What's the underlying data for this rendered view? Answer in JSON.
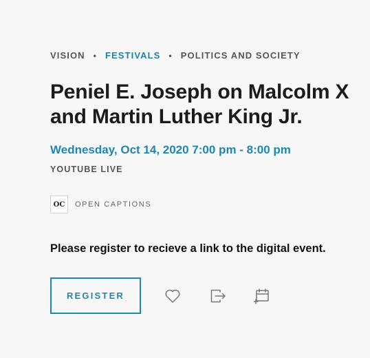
{
  "categories": [
    {
      "label": "VISION",
      "active": false
    },
    {
      "label": "FESTIVALS",
      "active": true
    },
    {
      "label": "POLITICS AND SOCIETY",
      "active": false
    }
  ],
  "separator": "•",
  "event": {
    "title": "Peniel E. Joseph on Malcolm X and Martin Luther King Jr.",
    "datetime": "Wednesday, Oct 14, 2020 7:00 pm - 8:00 pm",
    "venue": "YOUTUBE LIVE"
  },
  "accessibility": {
    "icon_text": "OC",
    "label": "OPEN CAPTIONS"
  },
  "notice": "Please register to recieve a link to the digital event.",
  "actions": {
    "register_label": "REGISTER",
    "icons": [
      "heart-icon",
      "share-icon",
      "calendar-add-icon"
    ]
  },
  "colors": {
    "accent": "#1f86b1",
    "background": "#f7f7f7",
    "text": "#1b1b1b",
    "muted": "#555555"
  }
}
